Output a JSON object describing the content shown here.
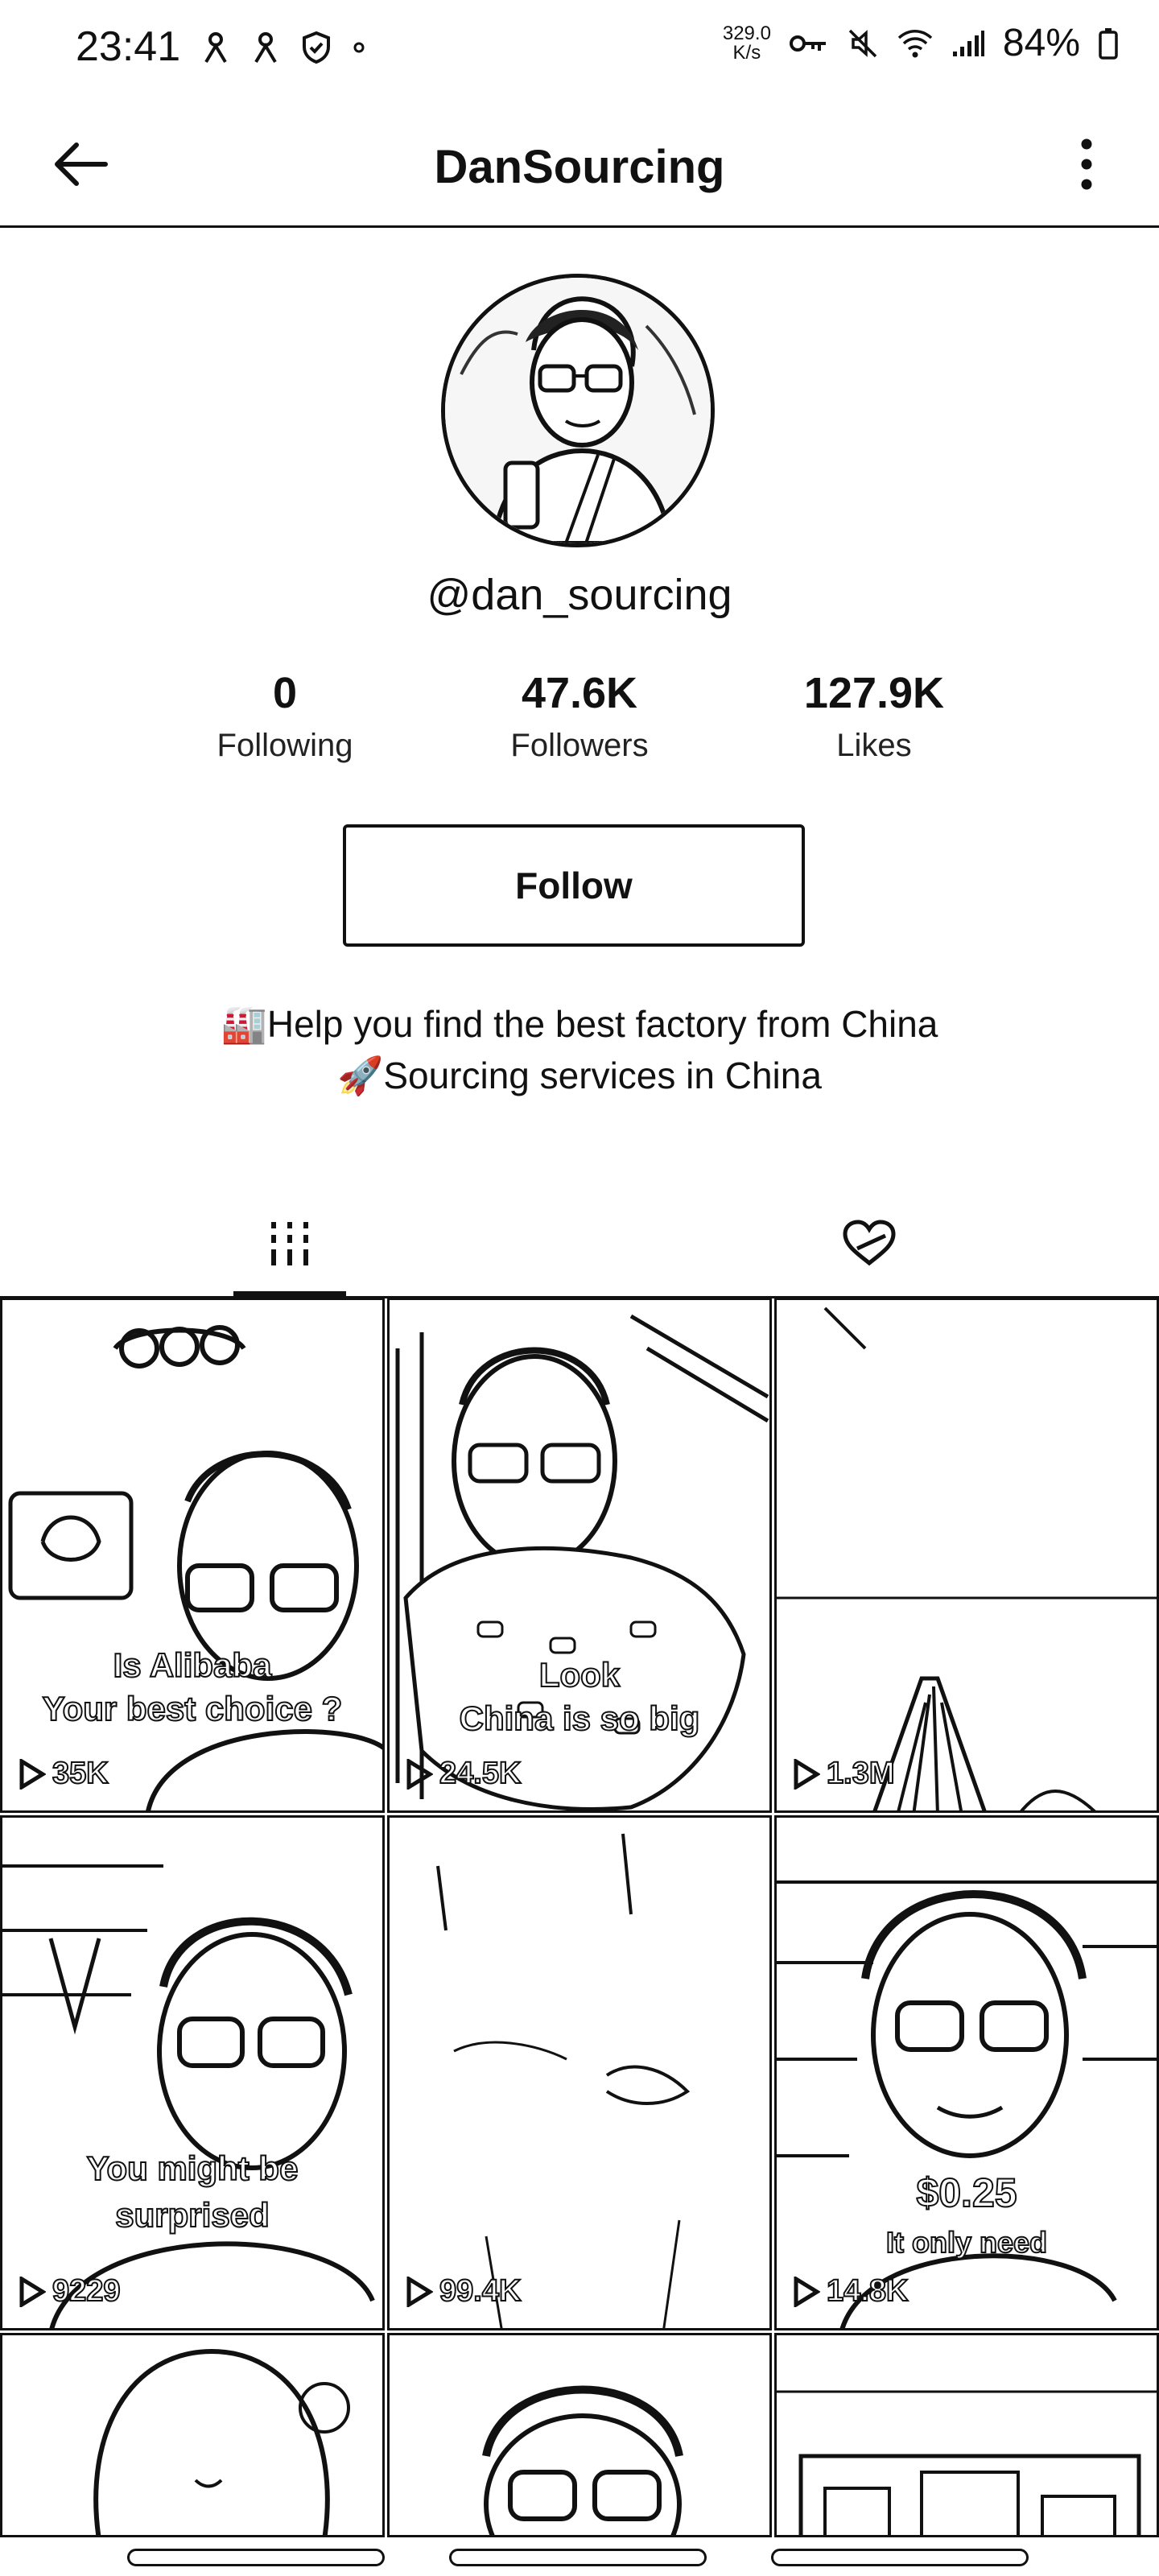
{
  "status_bar": {
    "time": "23:41",
    "net_speed_value": "329.0",
    "net_speed_unit": "K/s",
    "battery": "84%"
  },
  "header": {
    "title": "DanSourcing"
  },
  "profile": {
    "username": "@dan_sourcing",
    "stats": [
      {
        "value": "0",
        "label": "Following"
      },
      {
        "value": "47.6K",
        "label": "Followers"
      },
      {
        "value": "127.9K",
        "label": "Likes"
      }
    ],
    "follow_label": "Follow",
    "bio_line1": "🏭Help you find the best factory from China",
    "bio_line2": "🚀Sourcing services in China"
  },
  "videos": [
    {
      "caption1": "Is Alibaba",
      "caption2": "Your best choice ?",
      "views": "35K"
    },
    {
      "caption1": "Look",
      "caption2": "China is so big",
      "views": "24.5K"
    },
    {
      "caption1": "",
      "caption2": "",
      "views": "1.3M"
    },
    {
      "caption1": "You might be",
      "caption2": "surprised",
      "views": "9229"
    },
    {
      "caption1": "",
      "caption2": "",
      "views": "99.4K"
    },
    {
      "caption1": "$0.25",
      "caption2": "It only need",
      "views": "14.8K"
    }
  ]
}
